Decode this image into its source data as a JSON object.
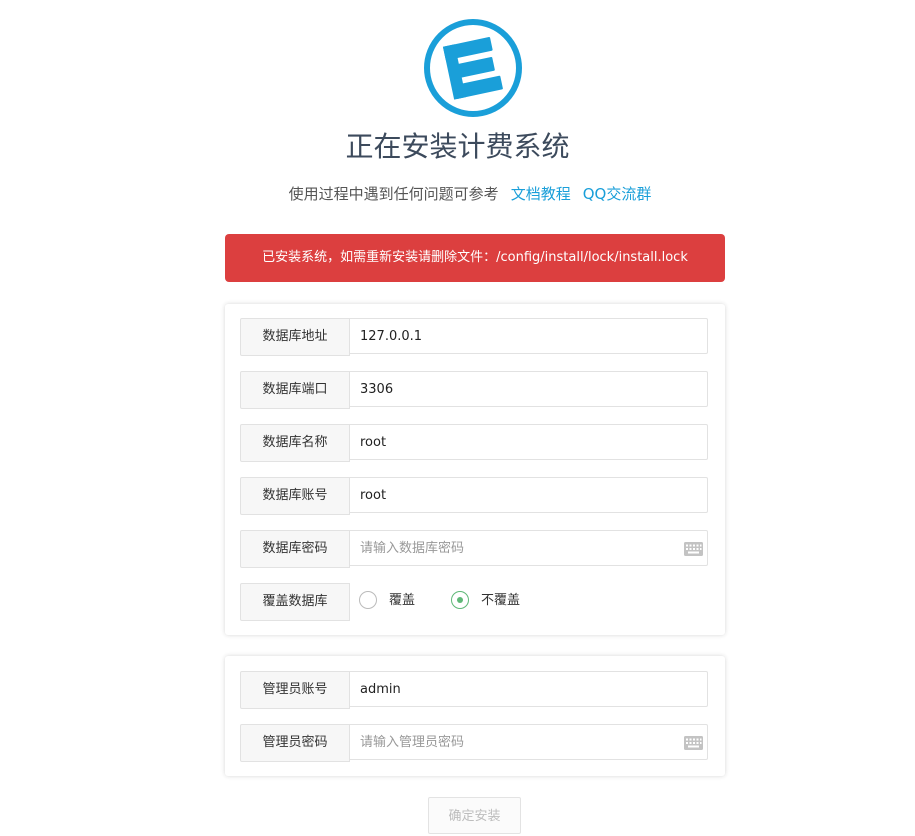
{
  "header": {
    "logo_icon": "installer-logo-icon",
    "title": "正在安装计费系统",
    "subtitle": "使用过程中遇到任何问题可参考",
    "link_docs": "文档教程",
    "link_qq": "QQ交流群"
  },
  "alert": {
    "text": "已安装系统，如需重新安装请删除文件：/config/install/lock/install.lock",
    "color": "#dc3f3f"
  },
  "db": {
    "host_label": "数据库地址",
    "host_value": "127.0.0.1",
    "port_label": "数据库端口",
    "port_value": "3306",
    "name_label": "数据库名称",
    "name_value": "root",
    "user_label": "数据库账号",
    "user_value": "root",
    "pass_label": "数据库密码",
    "pass_placeholder": "请输入数据库密码",
    "overwrite_label": "覆盖数据库",
    "overwrite_options": [
      "覆盖",
      "不覆盖"
    ],
    "overwrite_selected": "不覆盖"
  },
  "admin": {
    "user_label": "管理员账号",
    "user_value": "admin",
    "pass_label": "管理员密码",
    "pass_placeholder": "请输入管理员密码"
  },
  "submit_label": "确定安装",
  "colors": {
    "accent": "#1a9fd9",
    "radio_active": "#5fb878"
  }
}
